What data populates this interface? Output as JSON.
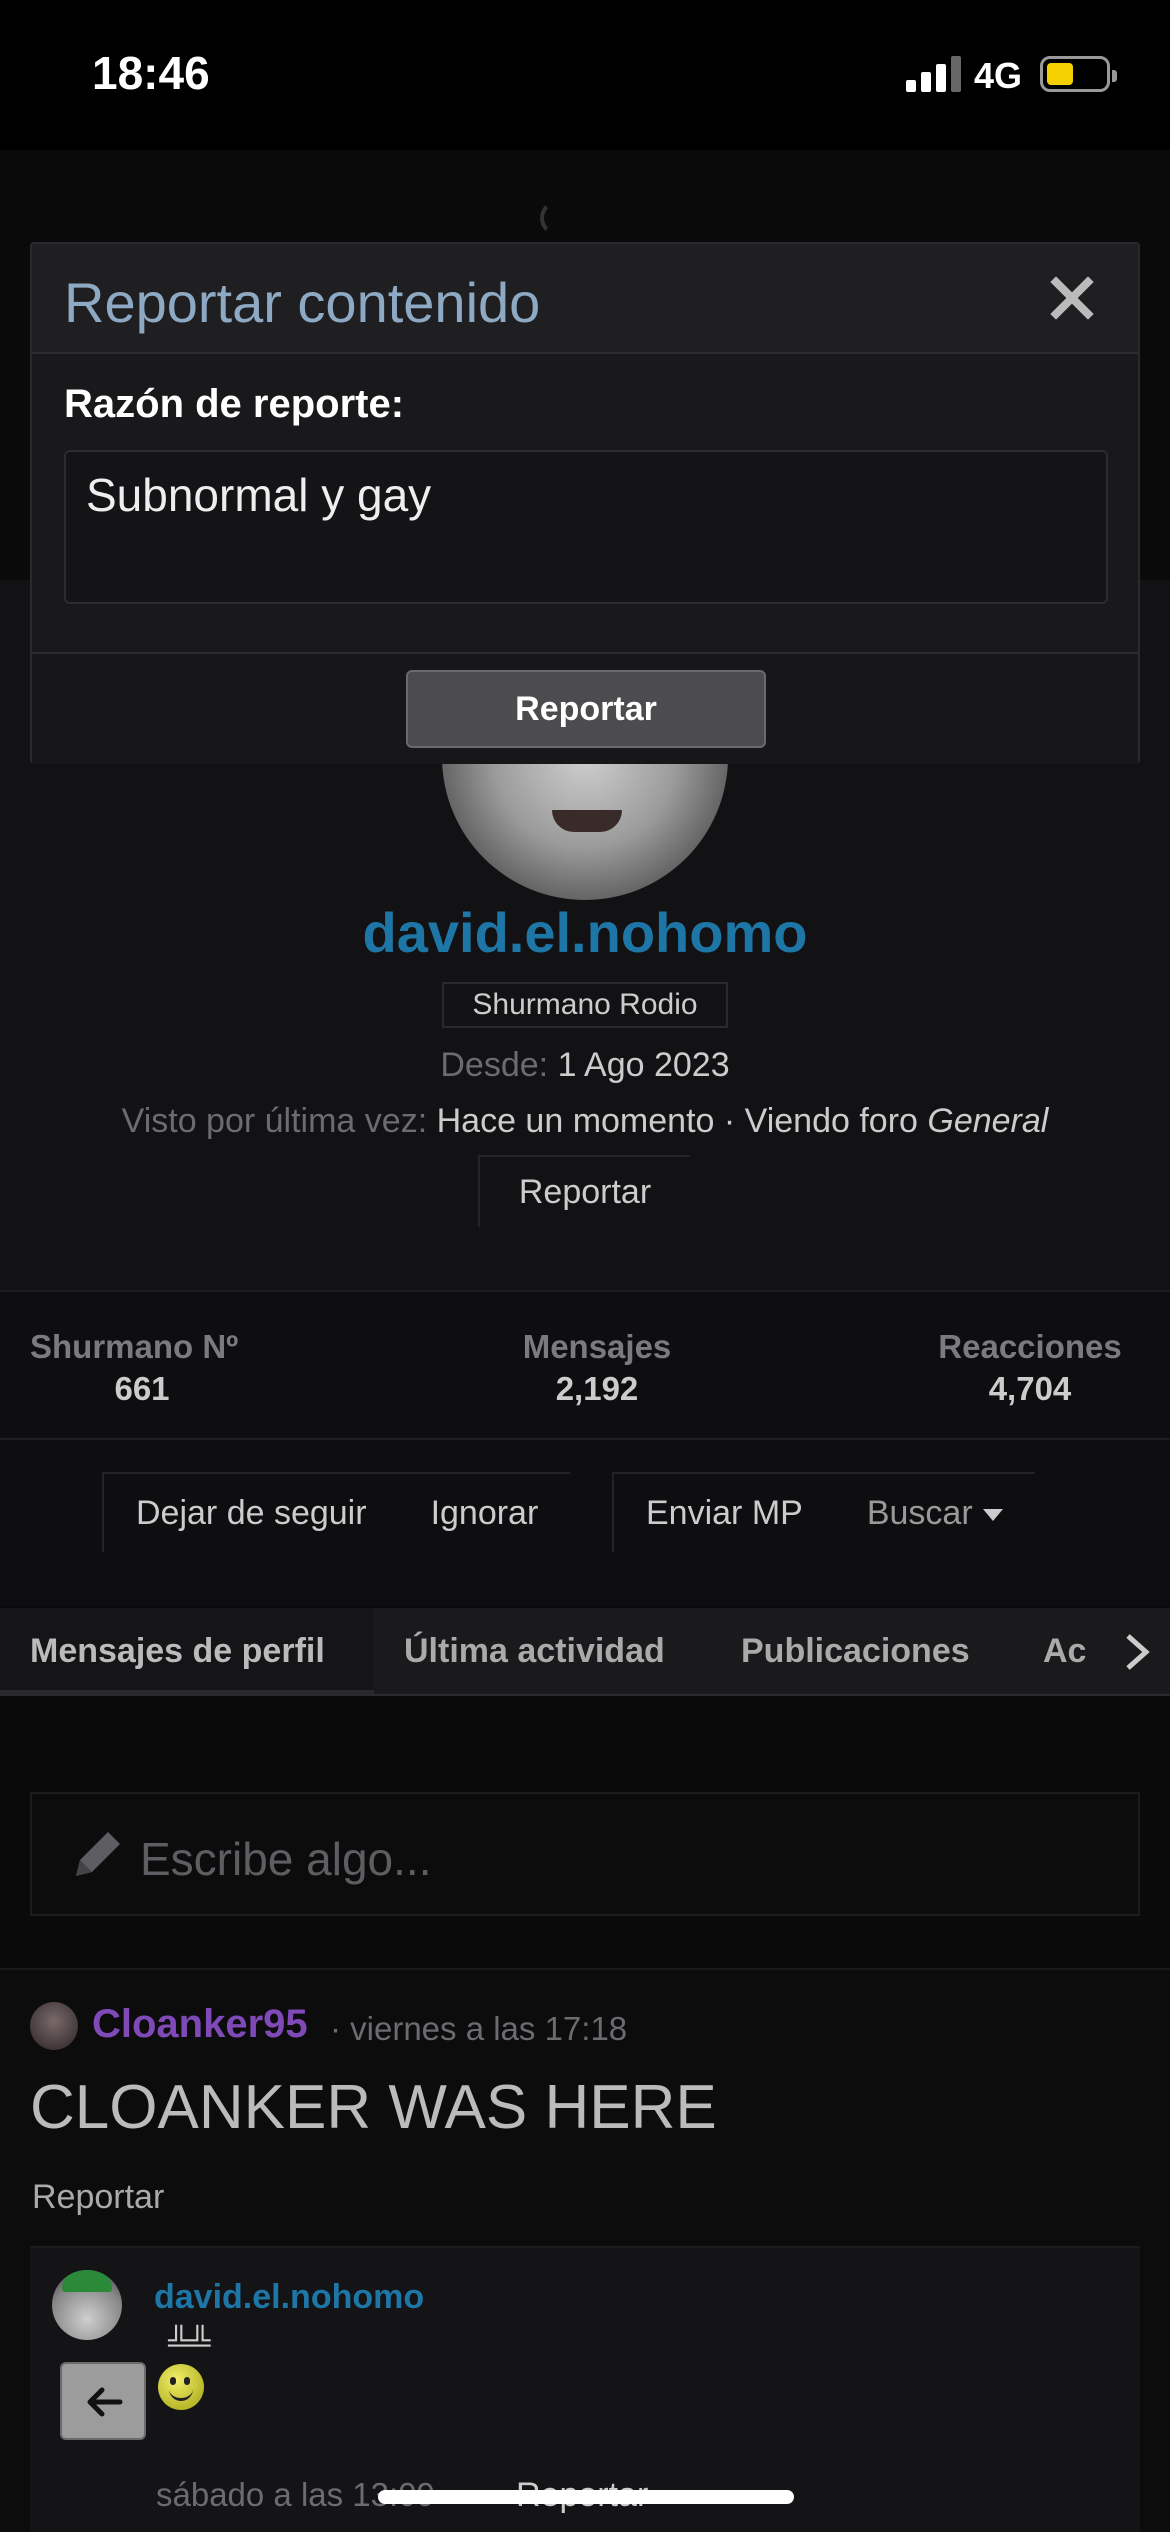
{
  "status_bar": {
    "time": "18:46",
    "network": "4G",
    "battery_color": "#f5d000"
  },
  "modal": {
    "title": "Reportar contenido",
    "reason_label": "Razón de reporte:",
    "reason_value": "Subnormal y gay",
    "submit_label": "Reportar"
  },
  "profile": {
    "username": "david.el.nohomo",
    "user_title": "Shurmano Rodio",
    "since_label": "Desde:",
    "since_value": "1 Ago 2023",
    "last_seen_label": "Visto por última vez:",
    "last_seen_value": "Hace un momento · Viendo foro ",
    "last_seen_forum": "General",
    "report_label": "Reportar",
    "username_color": "#1e76a6"
  },
  "stats": [
    {
      "label": "Shurmano Nº",
      "value": "661"
    },
    {
      "label": "Mensajes",
      "value": "2,192"
    },
    {
      "label": "Reacciones",
      "value": "4,704"
    }
  ],
  "actions": {
    "unfollow": "Dejar de seguir",
    "ignore": "Ignorar",
    "send_pm": "Enviar MP",
    "search": "Buscar"
  },
  "tabs": [
    "Mensajes de perfil",
    "Última actividad",
    "Publicaciones",
    "Ac"
  ],
  "composer": {
    "placeholder": "Escribe algo..."
  },
  "post": {
    "author": "Cloanker95",
    "time": "· viernes a las 17:18",
    "body": "CLOANKER WAS HERE",
    "report_label": "Reportar",
    "author_color": "#7f4ab8"
  },
  "reply": {
    "author": "david.el.nohomo",
    "glyph": "╩╩",
    "time": "sábado a las 13:09",
    "report_label": "Reportar"
  }
}
